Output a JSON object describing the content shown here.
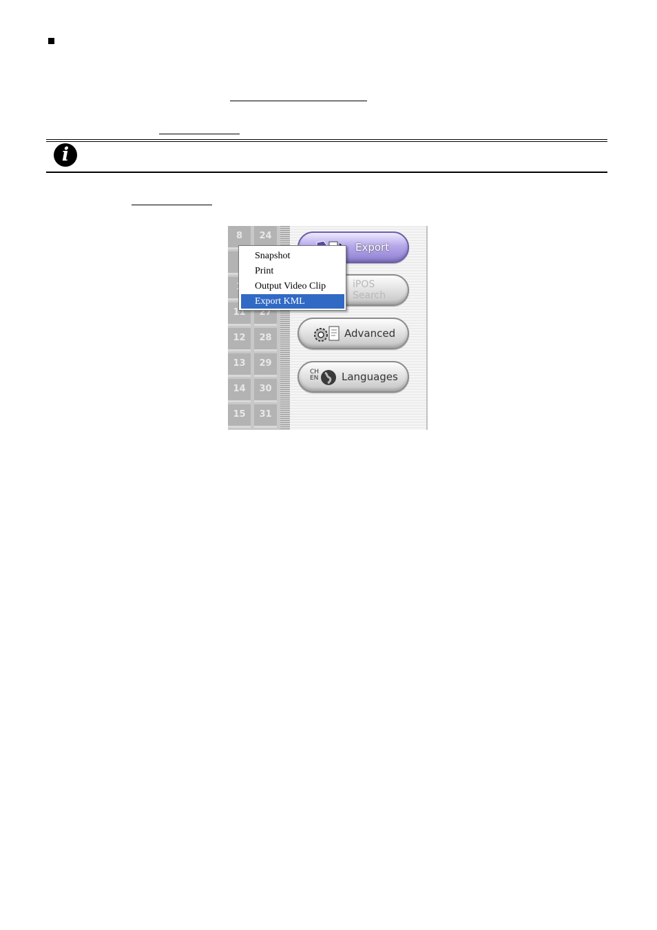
{
  "panel": {
    "grid_numbers_left": [
      "8",
      "",
      "1",
      "11",
      "12",
      "13",
      "14",
      "15"
    ],
    "grid_numbers_right": [
      "24",
      "",
      "",
      "27",
      "28",
      "29",
      "30",
      "31"
    ],
    "buttons": {
      "export": "Export",
      "ipos_line1": "iPOS",
      "ipos_line2": "Search",
      "advanced": "Advanced",
      "languages": "Languages",
      "lang_badge_top": "CH",
      "lang_badge_bottom": "EN"
    },
    "menu": {
      "items": [
        "Snapshot",
        "Print",
        "Output Video Clip",
        "Export KML"
      ],
      "selected_index": 3
    }
  },
  "info_icon_glyph": "i",
  "colors": {
    "menu_highlight": "#316ac5",
    "export_button": "#9a8ad8"
  }
}
